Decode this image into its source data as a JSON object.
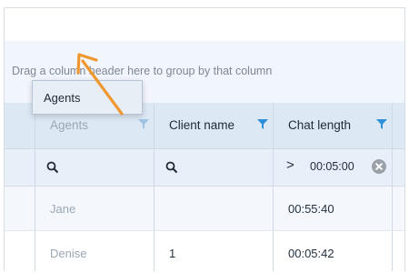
{
  "group_panel": {
    "hint": "Drag a column header here to group by that column"
  },
  "columns": [
    {
      "label": "Agents"
    },
    {
      "label": "Client name"
    },
    {
      "label": "Chat length"
    }
  ],
  "filter": {
    "operator": ">",
    "value": "00:05:00"
  },
  "rows": [
    {
      "agent": "Jane",
      "client": "",
      "length": "00:55:40"
    },
    {
      "agent": "Denise",
      "client": "1",
      "length": "00:05:42"
    }
  ],
  "drag_ghost": {
    "label": "Agents"
  },
  "colors": {
    "filter_icon": "#2f8fd8",
    "arrow": "#f0972f"
  }
}
